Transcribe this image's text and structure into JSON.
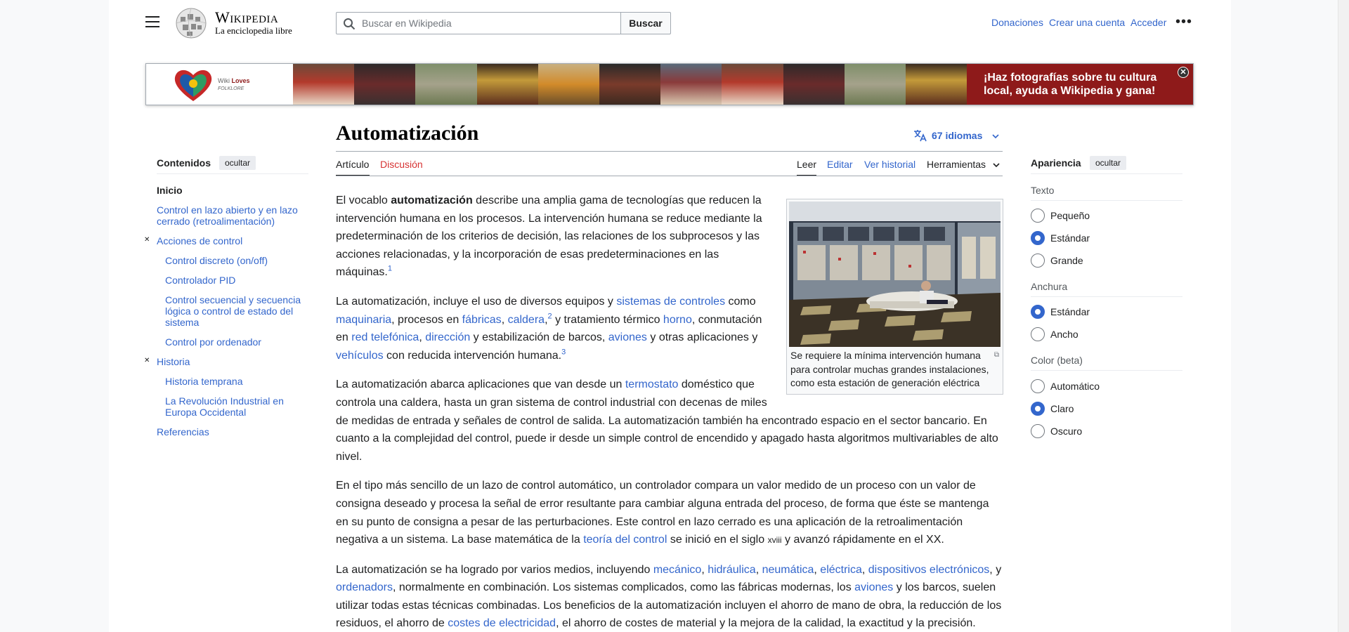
{
  "header": {
    "wordmark": "Wikipedia",
    "tagline": "La enciclopedia libre",
    "search_placeholder": "Buscar en Wikipedia",
    "search_button": "Buscar",
    "links": {
      "donate": "Donaciones",
      "create_account": "Crear una cuenta",
      "login": "Acceder"
    }
  },
  "banner": {
    "logo_line1": "Wiki",
    "logo_line1_bold": "Loves",
    "logo_line2": "FOLKLORE",
    "cta_line1": "¡Haz fotografías sobre tu cultura",
    "cta_line2": "local, ayuda a Wikipedia y gana!",
    "close_symbol": "✕"
  },
  "page": {
    "title": "Automatización",
    "languages": "67 idiomas"
  },
  "tabs": {
    "article": "Artículo",
    "talk": "Discusión",
    "read": "Leer",
    "edit": "Editar",
    "history": "Ver historial",
    "tools": "Herramientas"
  },
  "toc": {
    "heading": "Contenidos",
    "hide": "ocultar",
    "items": [
      "Inicio",
      "Control en lazo abierto y en lazo",
      "cerrado (retroalimentación)",
      "Acciones de control",
      "Control discreto (on/off)",
      "Controlador PID",
      "Control secuencial y secuencia",
      "lógica o control de estado del",
      "sistema",
      "Control por ordenador",
      "Historia",
      "Historia temprana",
      "La Revolución Industrial en",
      "Europa Occidental",
      "Referencias"
    ]
  },
  "appearance": {
    "heading": "Apariencia",
    "hide": "ocultar",
    "text_label": "Texto",
    "text_options": [
      "Pequeño",
      "Estándar",
      "Grande"
    ],
    "text_selected": "Estándar",
    "width_label": "Anchura",
    "width_options": [
      "Estándar",
      "Ancho"
    ],
    "width_selected": "Estándar",
    "color_label": "Color (beta)",
    "color_options": [
      "Automático",
      "Claro",
      "Oscuro"
    ],
    "color_selected": "Claro"
  },
  "figure": {
    "caption": "Se requiere la mínima intervención humana para controlar muchas grandes instalaciones, como esta estación de generación eléctrica"
  },
  "article": {
    "p1": [
      "El vocablo ",
      "automatización",
      " describe una amplia gama de tecnologías que reducen la intervención humana en los procesos. La intervención humana se reduce mediante la predeterminación de los criterios de decisión, las relaciones de los subprocesos y las acciones relacionadas, y la incorporación de esas predeterminaciones en las máquinas.",
      "1"
    ],
    "p2": [
      "La automatización, incluye el uso de diversos equipos y ",
      "sistemas de controles",
      " como ",
      "maquinaria",
      ", procesos en ",
      "fábricas",
      ", ",
      "caldera",
      ",",
      "2",
      " y tratamiento térmico ",
      "horno",
      ", conmutación en ",
      "red telefónica",
      ", ",
      "dirección",
      " y estabilización de barcos, ",
      "aviones",
      " y otras aplicaciones y ",
      "vehículos",
      " con reducida intervención humana.",
      "3"
    ],
    "p3": [
      "La automatización abarca aplicaciones que van desde un ",
      "termostato",
      " doméstico que controla una caldera, hasta un gran sistema de control industrial con decenas de miles de medidas de entrada y señales de control de salida. La automatización también ha encontrado espacio en el sector bancario. En cuanto a la complejidad del control, puede ir desde un simple control de encendido y apagado hasta algoritmos multivariables de alto nivel."
    ],
    "p4": [
      "En el tipo más sencillo de un lazo de control automático, un controlador compara un valor medido de un proceso con un valor de consigna deseado y procesa la señal de error resultante para cambiar alguna entrada del proceso, de forma que éste se mantenga en su punto de consigna a pesar de las perturbaciones. Este control en lazo cerrado es una aplicación de la retroalimentación negativa a un sistema. La base matemática de la ",
      "teoría del control",
      " se inició en el siglo ",
      "xviii",
      " y avanzó rápidamente en el XX."
    ],
    "p5": [
      "La automatización se ha logrado por varios medios, incluyendo ",
      "mecánico",
      ", ",
      "hidráulica",
      ", ",
      "neumática",
      ", ",
      "eléctrica",
      ", ",
      "dispositivos electrónicos",
      ", y ",
      "ordenadors",
      ", normalmente en combinación. Los sistemas complicados, como las fábricas modernas, los ",
      "aviones",
      " y los barcos, suelen utilizar todas estas técnicas combinadas. Los beneficios de la automatización incluyen el ahorro de mano de obra, la reducción de los residuos, el ahorro de ",
      "costes de electricidad",
      ", el ahorro de costes de material y la mejora de la calidad, la exactitud y la precisión."
    ]
  }
}
